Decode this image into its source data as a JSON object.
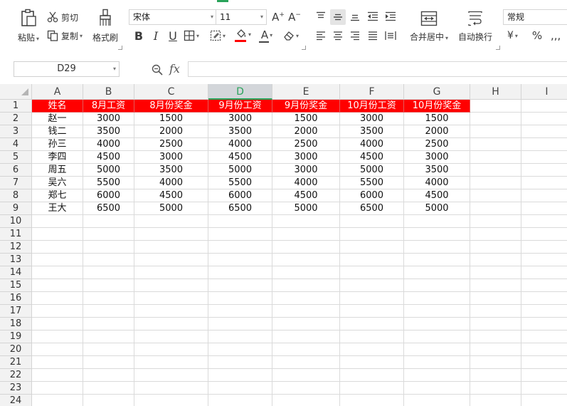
{
  "ribbon": {
    "clipboard": {
      "paste": "粘贴",
      "cut": "剪切",
      "copy": "复制",
      "format_painter": "格式刷"
    },
    "font": {
      "name": "宋体",
      "size": "11"
    },
    "alignment": {
      "merge_center": "合并居中",
      "wrap_text": "自动换行"
    },
    "number": {
      "format": "常规",
      "currency": "¥",
      "percent": "%"
    }
  },
  "formula_bar": {
    "cell_ref": "D29",
    "fx": "fx",
    "formula": ""
  },
  "sheet": {
    "columns": [
      "A",
      "B",
      "C",
      "D",
      "E",
      "F",
      "G",
      "H",
      "I"
    ],
    "selected_column": "D",
    "row_numbers": [
      "1",
      "2",
      "3",
      "4",
      "5",
      "6",
      "7",
      "8",
      "9",
      "10",
      "11",
      "12",
      "13",
      "14",
      "15",
      "16",
      "17",
      "18",
      "19",
      "20",
      "21",
      "22",
      "23",
      "24"
    ],
    "header_row": [
      "姓名",
      "8月工资",
      "8月份奖金",
      "9月份工资",
      "9月份奖金",
      "10月份工资",
      "10月份奖金"
    ],
    "rows": [
      [
        "赵一",
        "3000",
        "1500",
        "3000",
        "1500",
        "3000",
        "1500"
      ],
      [
        "钱二",
        "3500",
        "2000",
        "3500",
        "2000",
        "3500",
        "2000"
      ],
      [
        "孙三",
        "4000",
        "2500",
        "4000",
        "2500",
        "4000",
        "2500"
      ],
      [
        "李四",
        "4500",
        "3000",
        "4500",
        "3000",
        "4500",
        "3000"
      ],
      [
        "周五",
        "5000",
        "3500",
        "5000",
        "3000",
        "5000",
        "3500"
      ],
      [
        "吴六",
        "5500",
        "4000",
        "5500",
        "4000",
        "5500",
        "4000"
      ],
      [
        "郑七",
        "6000",
        "4500",
        "6000",
        "4500",
        "6000",
        "4500"
      ],
      [
        "王大",
        "6500",
        "5000",
        "6500",
        "5000",
        "6500",
        "5000"
      ]
    ]
  },
  "colors": {
    "header_fill": "#ff0000",
    "header_text": "#ffffff",
    "accent": "#2aa35a"
  }
}
